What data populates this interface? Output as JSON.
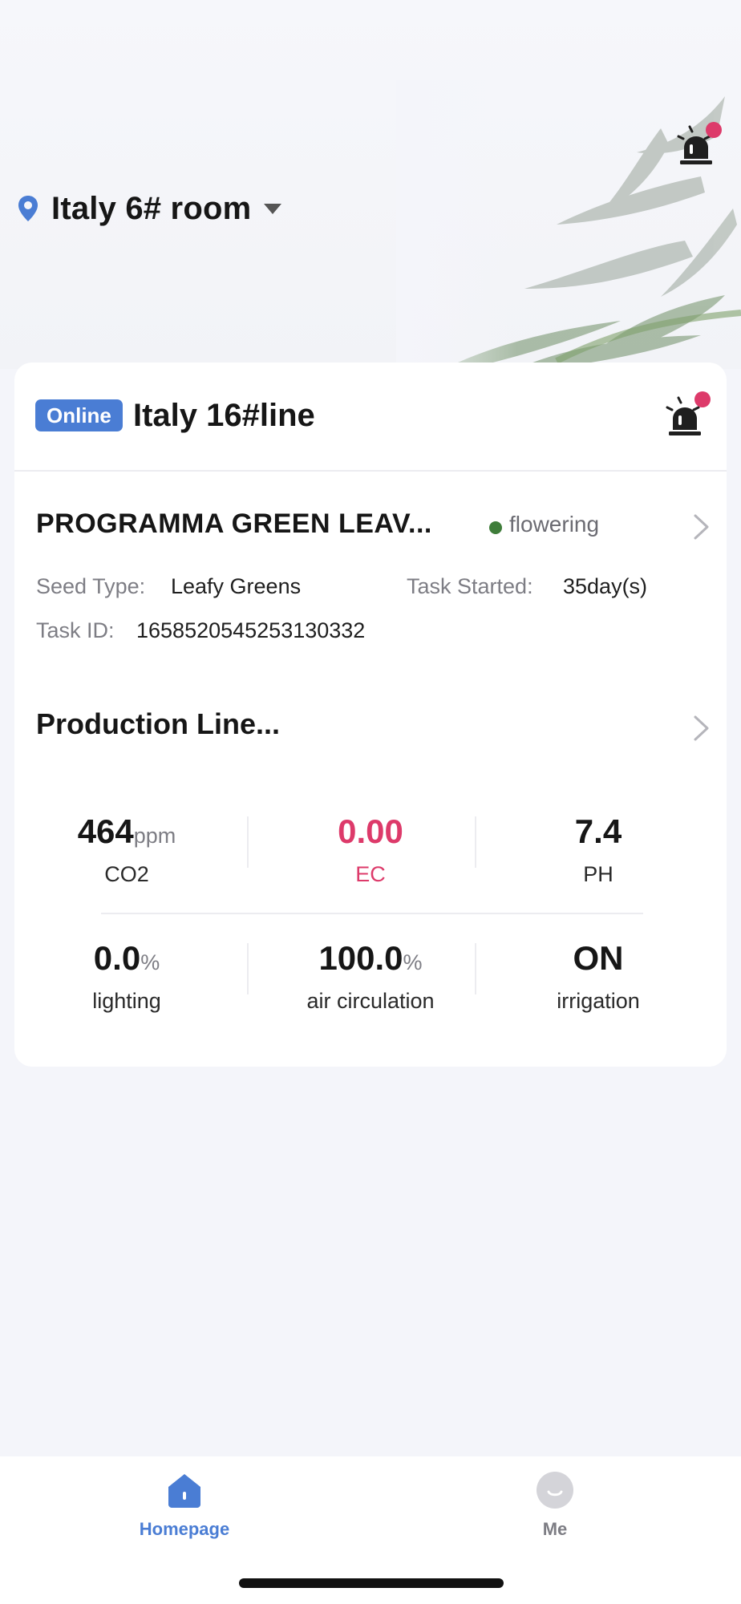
{
  "header": {
    "location": "Italy 6# room",
    "colors": {
      "accent": "#4a7dd4",
      "alert": "#dd3a6a",
      "stage": "#3f7d3a"
    }
  },
  "card": {
    "status_badge": "Online",
    "line_name": "Italy 16#line",
    "program": {
      "title": "PROGRAMMA GREEN LEAV...",
      "stage": "flowering",
      "seed_type_label": "Seed Type:",
      "seed_type_value": "Leafy Greens",
      "task_started_label": "Task Started:",
      "task_started_value": "35day(s)",
      "task_id_label": "Task ID:",
      "task_id_value": "1658520545253130332"
    },
    "production_title": "Production Line...",
    "metrics": [
      {
        "value": "464",
        "unit": "ppm",
        "label": "CO2"
      },
      {
        "value": "0.00",
        "unit": "",
        "label": "EC"
      },
      {
        "value": "7.4",
        "unit": "",
        "label": "PH"
      },
      {
        "value": "0.0",
        "unit": "%",
        "label": "lighting"
      },
      {
        "value": "100.0",
        "unit": "%",
        "label": "air circulation"
      },
      {
        "value": "ON",
        "unit": "",
        "label": "irrigation"
      }
    ]
  },
  "tabbar": {
    "home": "Homepage",
    "me": "Me"
  },
  "icons": [
    "location-pin-icon",
    "caret-down-icon",
    "alarm-siren-icon",
    "chevron-right-icon",
    "home-icon",
    "avatar-icon"
  ]
}
